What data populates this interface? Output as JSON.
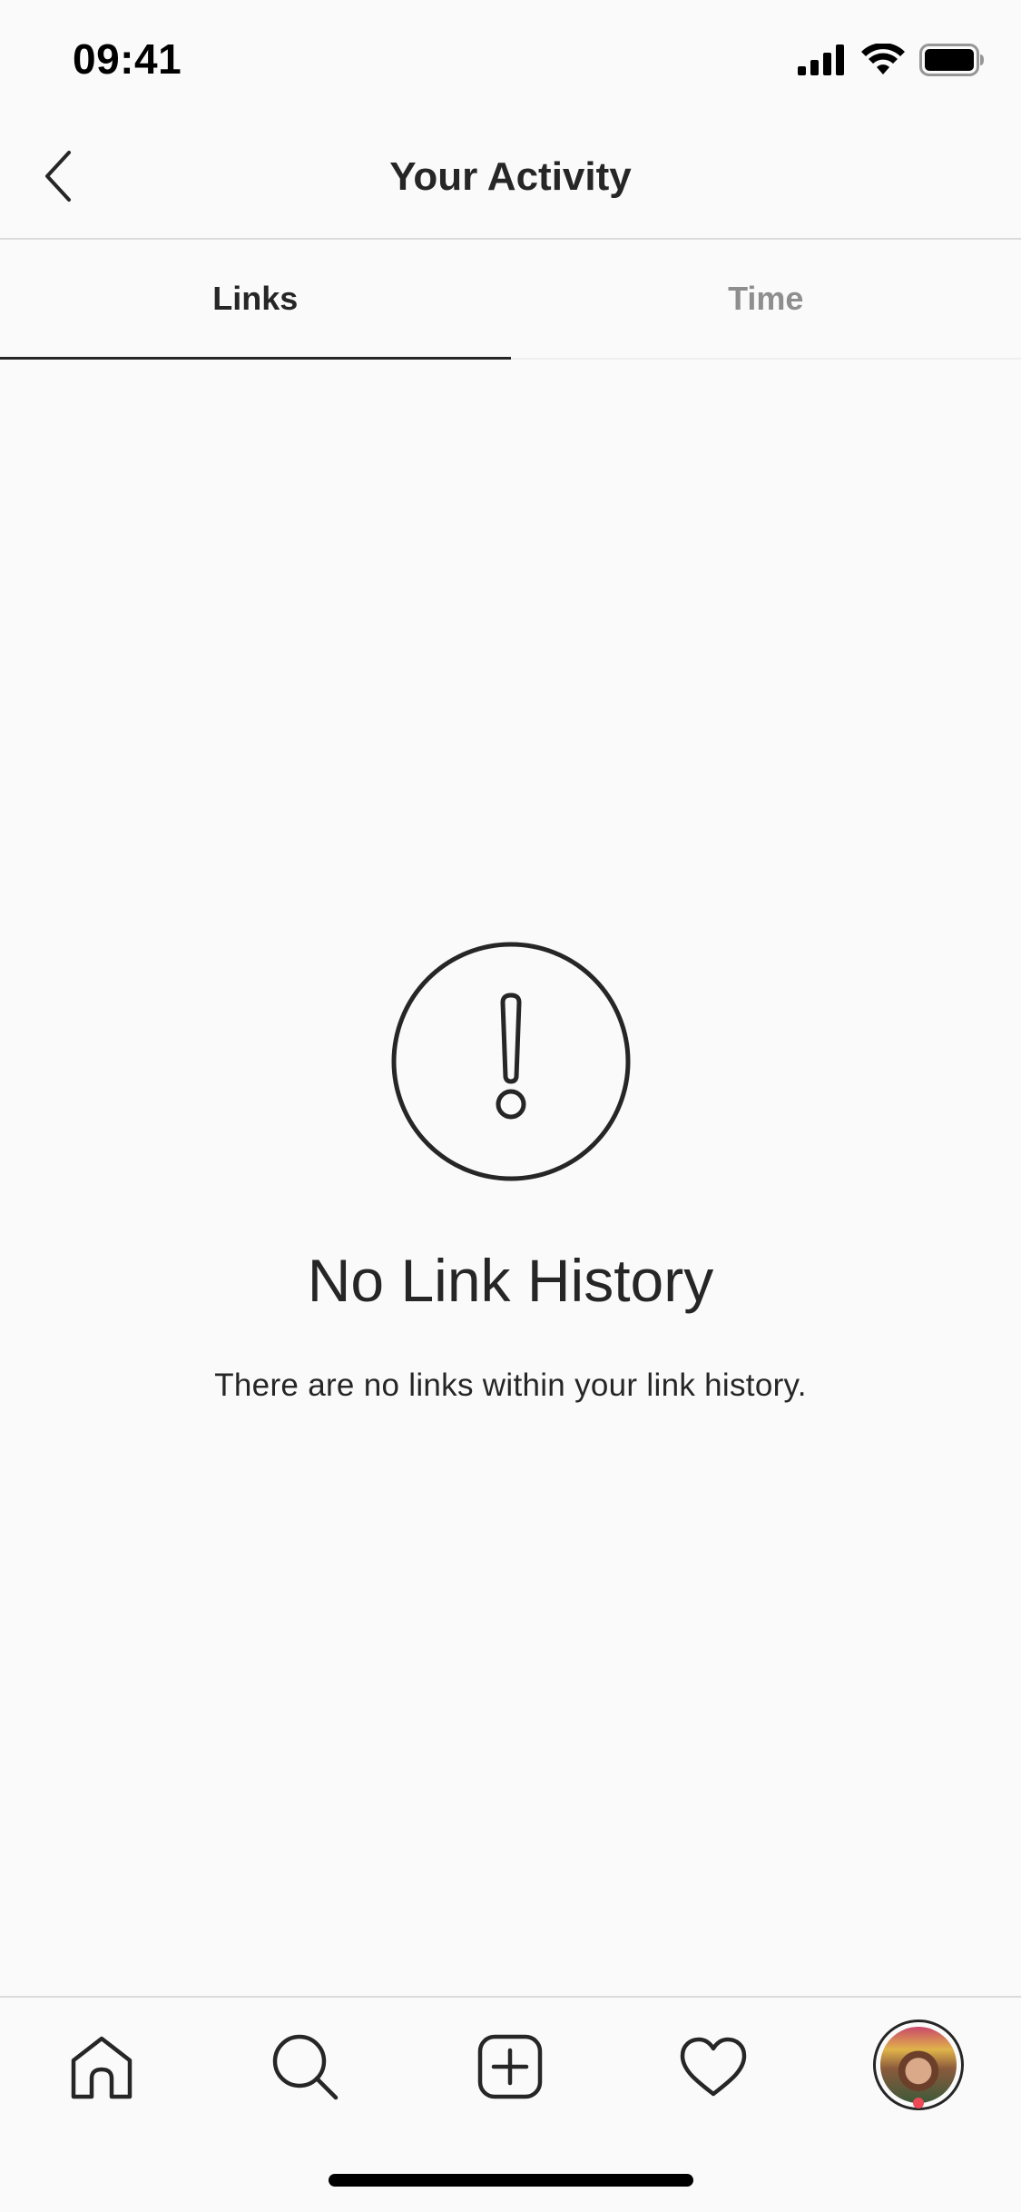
{
  "status_bar": {
    "time": "09:41",
    "icons": [
      "cellular-signal-icon",
      "wifi-icon",
      "battery-icon"
    ]
  },
  "header": {
    "title": "Your Activity",
    "back_icon": "chevron-left-icon"
  },
  "tabs": [
    {
      "label": "Links",
      "active": true
    },
    {
      "label": "Time",
      "active": false
    }
  ],
  "empty_state": {
    "icon": "alert-circle-icon",
    "title": "No Link History",
    "subtitle": "There are no links within your link history."
  },
  "tab_bar": {
    "items": [
      "home-icon",
      "search-icon",
      "new-post-icon",
      "activity-heart-icon",
      "profile-avatar"
    ],
    "profile_has_notification": true
  },
  "colors": {
    "background": "#fafafa",
    "text_primary": "#262626",
    "text_secondary": "#8e8e8e",
    "divider": "#dbdbdb",
    "notification": "#ed4956"
  }
}
